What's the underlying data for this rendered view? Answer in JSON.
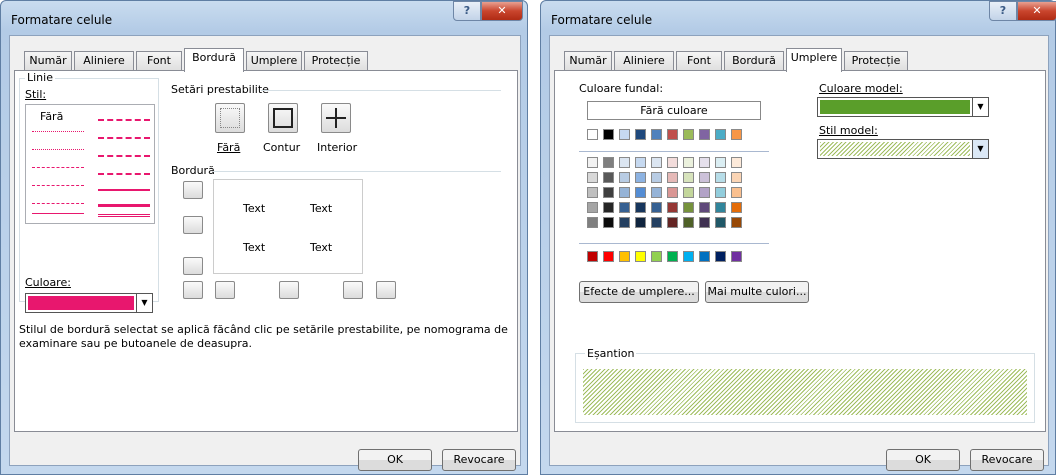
{
  "dialog1": {
    "title": "Formatare celule",
    "tabs": [
      "Număr",
      "Aliniere",
      "Font",
      "Bordură",
      "Umplere",
      "Protecție"
    ],
    "line_group": "Linie",
    "style_label": "Stil:",
    "none_label": "Fără",
    "color_label": "Culoare:",
    "color_value": "#e8176e",
    "presets_group": "Setări prestabilite",
    "preset_none": "Fără",
    "preset_outline": "Contur",
    "preset_inside": "Interior",
    "border_group": "Bordură",
    "preview_texts": [
      "Text",
      "Text",
      "Text",
      "Text"
    ],
    "help_text": "Stilul de bordură selectat se aplică făcând clic pe setările prestabilite, pe nomograma de examinare sau pe butoanele de deasupra.",
    "ok": "OK",
    "cancel": "Revocare"
  },
  "dialog2": {
    "title": "Formatare celule",
    "tabs": [
      "Număr",
      "Aliniere",
      "Font",
      "Bordură",
      "Umplere",
      "Protecție"
    ],
    "bg_color_label": "Culoare fundal:",
    "no_color": "Fără culoare",
    "pattern_color_label": "Culoare model:",
    "pattern_color_value": "#5a9e2a",
    "pattern_style_label": "Stil model:",
    "fill_effects": "Efecte de umplere...",
    "more_colors": "Mai multe culori...",
    "sample_label": "Eșantion",
    "ok": "OK",
    "cancel": "Revocare",
    "theme_top": [
      "#ffffff",
      "#000000",
      "#c6d9f1",
      "#1f497d",
      "#4f81bd",
      "#c0504d",
      "#9bbb59",
      "#8064a2",
      "#4bacc6",
      "#f79646"
    ],
    "theme_rows": [
      [
        "#f2f2f2",
        "#7f7f7f",
        "#dbe5f1",
        "#c6d9f0",
        "#dbe5f1",
        "#f2dcdb",
        "#ebf1dd",
        "#e5e0ec",
        "#dbeef3",
        "#fdeada"
      ],
      [
        "#d8d8d8",
        "#595959",
        "#b8cce4",
        "#8db3e2",
        "#b8cce4",
        "#e5b9b7",
        "#d7e3bc",
        "#ccc1d9",
        "#b7dde8",
        "#fbd5b5"
      ],
      [
        "#bfbfbf",
        "#3f3f3f",
        "#95b3d7",
        "#548dd4",
        "#95b3d7",
        "#d99694",
        "#c3d69b",
        "#b2a2c7",
        "#92cddc",
        "#fac08f"
      ],
      [
        "#a5a5a5",
        "#262626",
        "#366092",
        "#17365d",
        "#366092",
        "#953734",
        "#76923c",
        "#5f497a",
        "#31859b",
        "#e36c09"
      ],
      [
        "#7f7f7f",
        "#0c0c0c",
        "#244061",
        "#0f243e",
        "#244061",
        "#632423",
        "#4f6128",
        "#3f3151",
        "#205867",
        "#974806"
      ]
    ],
    "standard": [
      "#c00000",
      "#ff0000",
      "#ffc000",
      "#ffff00",
      "#92d050",
      "#00b050",
      "#00b0f0",
      "#0070c0",
      "#002060",
      "#7030a0"
    ]
  }
}
